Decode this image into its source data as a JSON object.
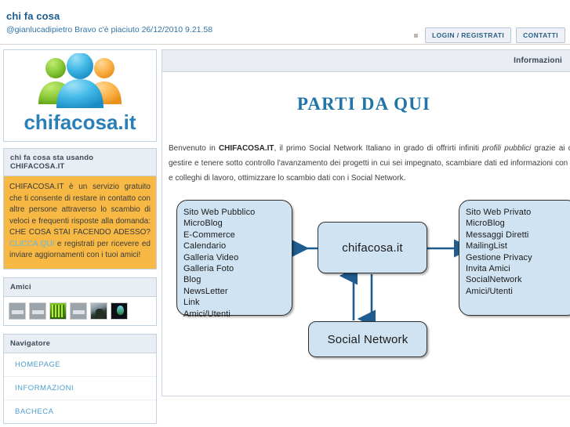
{
  "header": {
    "site_title": "chi fa cosa",
    "status_line": "@gianlucadipietro Bravo c'è piaciuto 26/12/2010 9.21.58",
    "nav_buttons": [
      {
        "label": "LOGIN / REGISTRATI",
        "name": "login-register-button"
      },
      {
        "label": "CONTATTI",
        "name": "contatti-button"
      }
    ],
    "bullet_icon": "square-bullet-icon"
  },
  "sidebar": {
    "logo": {
      "wordmark": "chifacosa.it",
      "icon": "three-people-group-icon",
      "person_colors": [
        "#7cc13a",
        "#35a9dd",
        "#f5a93c"
      ],
      "wordmark_color": "#2a7fb8"
    },
    "promo_panel": {
      "title": "chi fa cosa sta usando CHIFACOSA.IT",
      "background": "#f7b944",
      "text_before_link": "CHIFACOSA.IT è un servizio gratuito che ti consente di restare in contatto con altre persone attraverso lo scambio di veloci e frequenti risposte alla domanda: CHE COSA STAI FACENDO ADESSO? ",
      "link_label": "CLICCA QUI",
      "link_color": "#63b8e8",
      "text_after_link": " e registrati per ricevere ed inviare aggiornamenti con i tuoi amici!"
    },
    "amici_panel": {
      "title": "Amici",
      "avatars": [
        {
          "name": "avatar-1",
          "style": "av-gray"
        },
        {
          "name": "avatar-2",
          "style": "av-gray"
        },
        {
          "name": "avatar-3",
          "style": "av-green"
        },
        {
          "name": "avatar-4",
          "style": "av-gray"
        },
        {
          "name": "avatar-5",
          "style": "av-photo"
        },
        {
          "name": "avatar-6",
          "style": "av-dark"
        }
      ]
    },
    "navigatore_panel": {
      "title": "Navigatore",
      "items": [
        {
          "label": "HOMEPAGE",
          "name": "sidebar-item-homepage"
        },
        {
          "label": "INFORMAZIONI",
          "name": "sidebar-item-informazioni"
        },
        {
          "label": "BACHECA",
          "name": "sidebar-item-bacheca"
        }
      ],
      "link_color": "#4e9ccb"
    }
  },
  "main": {
    "panel_header_title": "Informazioni",
    "heading": "PARTI DA QUI",
    "heading_color": "#1f74a8",
    "intro": {
      "part1": "Benvenuto in ",
      "bold1": "CHIFACOSA.IT",
      "part2": ", il primo Social Network Italiano in grado di offrirti infiniti ",
      "italic1": "profili pubblici",
      "part3": " grazie ai quali potrai gestire e tenere sotto controllo l'avanzamento dei progetti in cui sei impegnato, scambiare dati ed informazioni con i tuoi amici e colleghi di lavoro, ottimizzare lo scambio dati con i Social Network."
    }
  },
  "diagram": {
    "box_fill": "#cfe3f2",
    "box_stroke": "#2f2f2f",
    "arrow_color": "#1f5c8f",
    "box_public": {
      "title": "Sito Web Pubblico",
      "items_text": "Sito Web Pubblico\n  MicroBlog\n  E-Commerce\n  Calendario\n  Galleria Video\n  Galleria Foto\n  Blog\n  NewsLetter\n  Link\n  Amici/Utenti"
    },
    "box_private": {
      "title": "Sito Web Privato",
      "items_text": "Sito Web Privato\n  MicroBlog\n  Messaggi Diretti\n  MailingList\n  Gestione Privacy\n  Invita Amici\n  SocialNetwork\n  Amici/Utenti"
    },
    "box_center": {
      "label": "chifacosa.it"
    },
    "box_social": {
      "label": "Social Network"
    }
  }
}
